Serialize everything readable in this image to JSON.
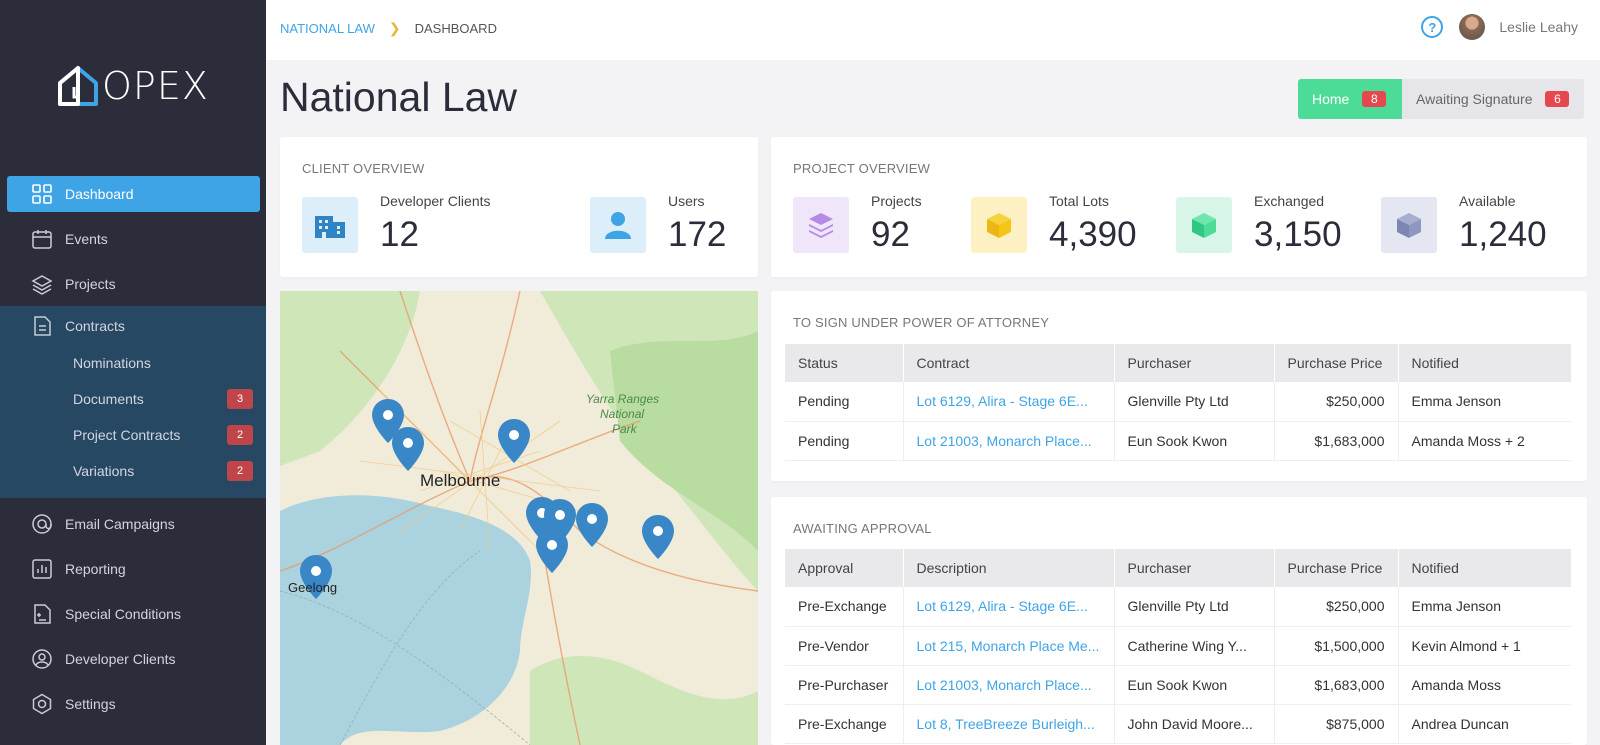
{
  "app": {
    "logo": "OPEX"
  },
  "sidebar": {
    "items": [
      {
        "label": "Dashboard",
        "icon": "grid-icon"
      },
      {
        "label": "Events",
        "icon": "calendar-icon"
      },
      {
        "label": "Projects",
        "icon": "layers-icon"
      },
      {
        "label": "Contracts",
        "icon": "document-icon"
      },
      {
        "label": "Email Campaigns",
        "icon": "at-icon"
      },
      {
        "label": "Reporting",
        "icon": "chart-icon"
      },
      {
        "label": "Special Conditions",
        "icon": "doc-plus-icon"
      },
      {
        "label": "Developer Clients",
        "icon": "user-circle-icon"
      },
      {
        "label": "Settings",
        "icon": "hexagon-icon"
      }
    ],
    "contracts_sub": [
      {
        "label": "Nominations",
        "badge": ""
      },
      {
        "label": "Documents",
        "badge": "3"
      },
      {
        "label": "Project Contracts",
        "badge": "2"
      },
      {
        "label": "Variations",
        "badge": "2"
      }
    ]
  },
  "header": {
    "breadcrumb": [
      "NATIONAL LAW",
      "DASHBOARD"
    ],
    "help": "?",
    "user_name": "Leslie Leahy"
  },
  "page": {
    "title": "National Law"
  },
  "tabs": [
    {
      "label": "Home",
      "badge": "8"
    },
    {
      "label": "Awaiting Signature",
      "badge": "6"
    }
  ],
  "client_overview": {
    "title": "CLIENT OVERVIEW",
    "stats": [
      {
        "label": "Developer Clients",
        "value": "12"
      },
      {
        "label": "Users",
        "value": "172"
      }
    ]
  },
  "project_overview": {
    "title": "PROJECT OVERVIEW",
    "stats": [
      {
        "label": "Projects",
        "value": "92"
      },
      {
        "label": "Total Lots",
        "value": "4,390"
      },
      {
        "label": "Exchanged",
        "value": "3,150"
      },
      {
        "label": "Available",
        "value": "1,240"
      }
    ]
  },
  "map": {
    "labels": [
      "Melbourne",
      "Geelong",
      "Yarra Ranges",
      "National",
      "Park"
    ]
  },
  "poa": {
    "title": "TO SIGN UNDER POWER OF ATTORNEY",
    "headers": [
      "Status",
      "Contract",
      "Purchaser",
      "Purchase Price",
      "Notified"
    ],
    "rows": [
      [
        "Pending",
        "Lot 6129, Alira - Stage 6E...",
        "Glenville Pty Ltd",
        "$250,000",
        "Emma Jenson"
      ],
      [
        "Pending",
        "Lot 21003, Monarch Place...",
        "Eun Sook Kwon",
        "$1,683,000",
        "Amanda Moss + 2"
      ]
    ]
  },
  "approval": {
    "title": "AWAITING APPROVAL",
    "headers": [
      "Approval",
      "Description",
      "Purchaser",
      "Purchase Price",
      "Notified"
    ],
    "rows": [
      [
        "Pre-Exchange",
        "Lot 6129, Alira - Stage 6E...",
        "Glenville Pty Ltd",
        "$250,000",
        "Emma Jenson"
      ],
      [
        "Pre-Vendor",
        "Lot 215, Monarch Place Me...",
        "Catherine Wing Y...",
        "$1,500,000",
        "Kevin Almond + 1"
      ],
      [
        "Pre-Purchaser",
        "Lot 21003, Monarch Place...",
        "Eun Sook Kwon",
        "$1,683,000",
        "Amanda Moss"
      ],
      [
        "Pre-Exchange",
        "Lot 8, TreeBreeze Burleigh...",
        "John David Moore...",
        "$875,000",
        "Andrea Duncan"
      ]
    ]
  },
  "colors": {
    "accent": "#3ea4e6",
    "sidebar": "#2b2d3a",
    "success": "#4ddb98",
    "danger": "#e5484d"
  }
}
